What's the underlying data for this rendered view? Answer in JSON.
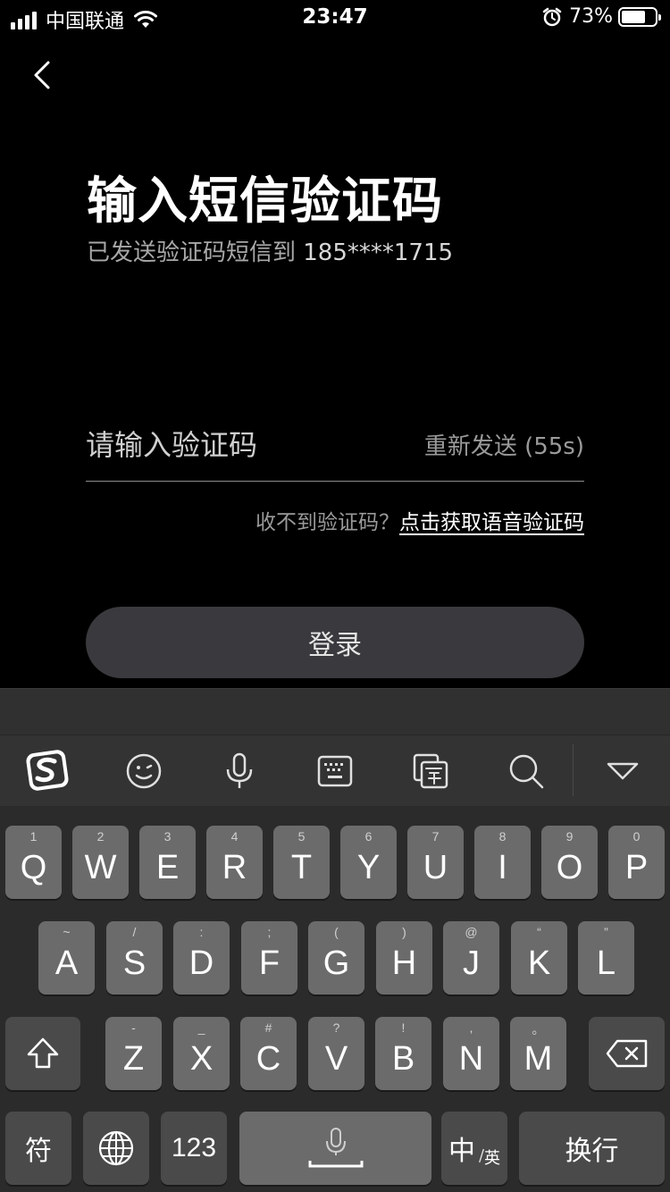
{
  "status_bar": {
    "carrier": "中国联通",
    "time": "23:47",
    "battery": "73%",
    "battery_level": 0.73,
    "icons": [
      "signal-icon",
      "wifi-icon",
      "alarm-icon",
      "battery-icon"
    ]
  },
  "page": {
    "title": "输入短信验证码",
    "subtitle_prefix": "已发送验证码短信到 ",
    "phone": "185****1715",
    "code_placeholder": "请输入验证码",
    "resend": "重新发送 (55s)",
    "voice_prefix": "收不到验证码？",
    "voice_link": "点击获取语音验证码",
    "login": "登录"
  },
  "keyboard": {
    "toolbar_icons": [
      "sogou-logo-icon",
      "emoji-icon",
      "microphone-icon",
      "keyboard-icon",
      "translate-icon",
      "search-icon",
      "collapse-keyboard-icon"
    ],
    "row1": [
      {
        "k": "Q",
        "h": "1"
      },
      {
        "k": "W",
        "h": "2"
      },
      {
        "k": "E",
        "h": "3"
      },
      {
        "k": "R",
        "h": "4"
      },
      {
        "k": "T",
        "h": "5"
      },
      {
        "k": "Y",
        "h": "6"
      },
      {
        "k": "U",
        "h": "7"
      },
      {
        "k": "I",
        "h": "8"
      },
      {
        "k": "O",
        "h": "9"
      },
      {
        "k": "P",
        "h": "0"
      }
    ],
    "row2": [
      {
        "k": "A",
        "h": "~"
      },
      {
        "k": "S",
        "h": "/"
      },
      {
        "k": "D",
        "h": ":"
      },
      {
        "k": "F",
        "h": ";"
      },
      {
        "k": "G",
        "h": "("
      },
      {
        "k": "H",
        "h": ")"
      },
      {
        "k": "J",
        "h": "@"
      },
      {
        "k": "K",
        "h": "“"
      },
      {
        "k": "L",
        "h": "”"
      }
    ],
    "row3": [
      {
        "k": "Z",
        "h": "-"
      },
      {
        "k": "X",
        "h": "_"
      },
      {
        "k": "C",
        "h": "#"
      },
      {
        "k": "V",
        "h": "?"
      },
      {
        "k": "B",
        "h": "!"
      },
      {
        "k": "N",
        "h": ","
      },
      {
        "k": "M",
        "h": "。"
      }
    ],
    "symbols": "符",
    "numbers": "123",
    "chinese": "中",
    "english": "英",
    "return": "换行"
  }
}
